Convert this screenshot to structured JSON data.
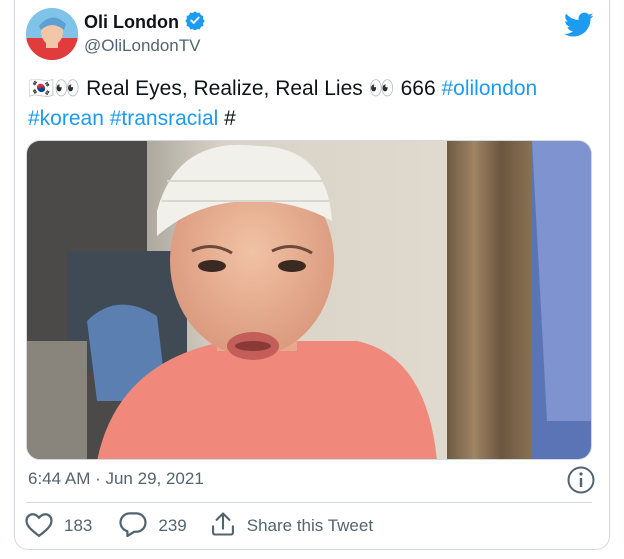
{
  "author": {
    "display_name": "Oli London",
    "handle": "@OliLondonTV",
    "verified": true
  },
  "tweet": {
    "emoji_prefix": "🇰🇷👀",
    "text_main": " Real Eyes, Realize, Real Lies ",
    "emoji_mid": "👀",
    "number": " 666 ",
    "hashtags": [
      "#olilondon",
      "#korean",
      "#transracial"
    ],
    "trailing": " #"
  },
  "meta": {
    "timestamp": "6:44 AM · Jun 29, 2021"
  },
  "actions": {
    "likes": "183",
    "replies": "239",
    "share_label": "Share this Tweet"
  },
  "colors": {
    "link": "#1d9bf0",
    "secondary_text": "#536471",
    "border": "#cfd9de"
  },
  "icons": [
    "verified-badge-icon",
    "twitter-bird-icon",
    "info-icon",
    "heart-icon",
    "reply-icon",
    "share-icon"
  ]
}
